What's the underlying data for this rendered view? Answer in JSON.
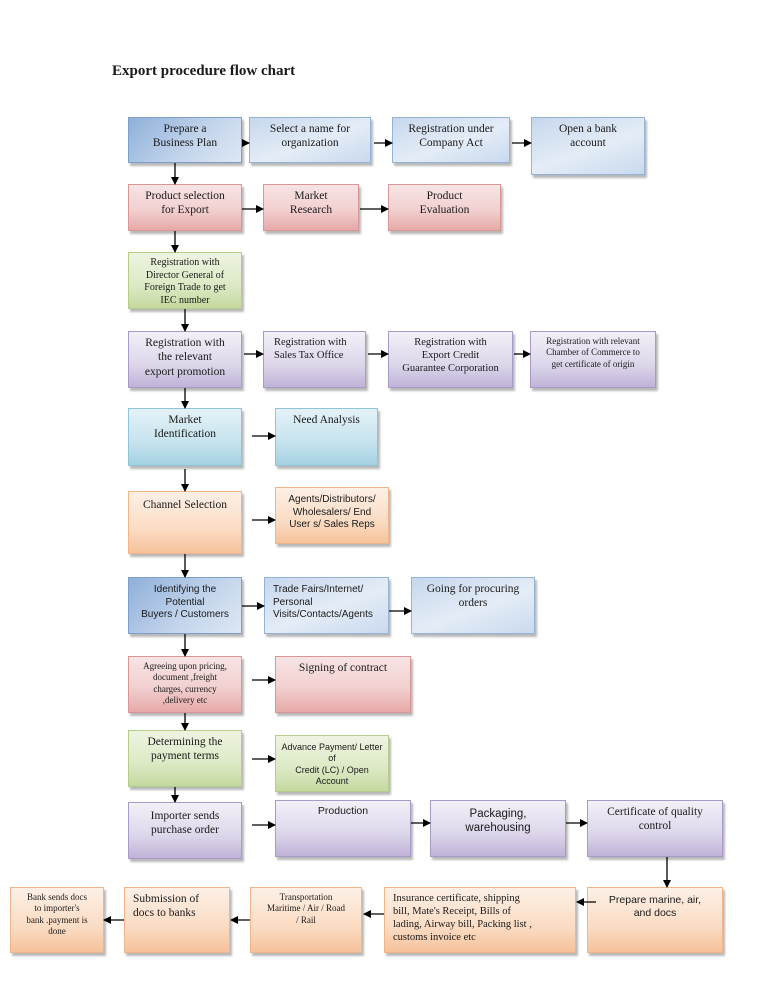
{
  "title": "Export procedure flow chart",
  "colors": {
    "blue": "#c6d7ec",
    "red": "#f2d0d0",
    "green": "#dce9c4",
    "purple": "#ddd6ea",
    "cyan": "#c6e3ee",
    "orange": "#fbdcc4",
    "arrow": "#000000"
  },
  "steps": {
    "business_plan": "Prepare a\nBusiness Plan",
    "select_name": "Select a name for\norganization",
    "company_act": "Registration under\nCompany Act",
    "bank_account": "Open a bank\naccount",
    "product_selection": "Product selection\nfor Export",
    "market_research": "Market\nResearch",
    "product_evaluation": "Product\nEvaluation",
    "dgft_registration": "Registration with\nDirector General of\nForeign Trade to get\nIEC number",
    "export_promotion": "Registration with\nthe relevant\nexport promotion",
    "sales_tax": "Registration with\nSales Tax Office",
    "ecgc": "Registration with\nExport Credit\nGuarantee Corporation",
    "chamber_commerce": "Registration with relevant\nChamber of Commerce to\nget certificate of origin",
    "market_identification": "Market\nIdentification",
    "need_analysis": "Need Analysis",
    "channel_selection": "Channel Selection",
    "channels": "Agents/Distributors/\nWholesalers/ End\nUser s/ Sales Reps",
    "identify_buyers": "Identifying the\nPotential\nBuyers / Customers",
    "trade_fairs": "Trade Fairs/Internet/\nPersonal\n Visits/Contacts/Agents",
    "procuring_orders": "Going for procuring\norders",
    "agree_pricing": "Agreeing upon pricing,\ndocument ,freight\ncharges, currency\n,delivery etc",
    "signing_contract": "Signing of contract",
    "payment_terms": "Determining the\npayment terms",
    "payment_methods": "Advance Payment/ Letter\nof\nCredit (LC) / Open\nAccount",
    "purchase_order": "Importer sends\npurchase order",
    "production": "Production",
    "packaging": "Packaging,\nwarehousing",
    "quality_certificate": "Certificate of quality\ncontrol",
    "prepare_docs": "Prepare marine, air,\nand docs",
    "shipping_docs": "Insurance certificate, shipping\nbill, Mate's Receipt, Bills of\nlading, Airway bill, Packing list ,\ncustoms invoice etc",
    "transportation": "Transportation\nMaritime / Air / Road\n/ Rail",
    "submission_docs": "Submission of\ndocs to banks",
    "bank_sends_docs": "Bank sends docs\nto importer's\nbank .payment is\ndone"
  }
}
